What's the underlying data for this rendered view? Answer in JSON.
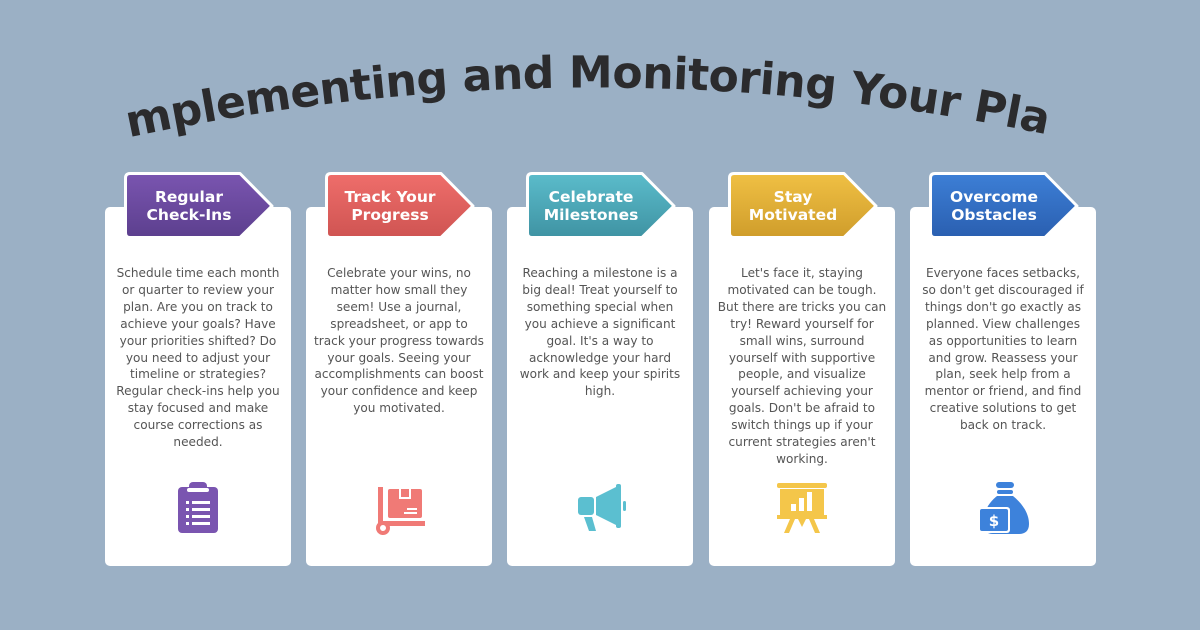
{
  "title": "Implementing and Monitoring Your Plan",
  "colors": {
    "background": "#9bb0c5",
    "title": "#2b2b2d",
    "card": "#ffffff",
    "body_text": "#555555"
  },
  "cards": [
    {
      "heading": "Regular\nCheck-Ins",
      "color_top": "#7a55b0",
      "color_bottom": "#5c3f8e",
      "icon": "clipboard-list-icon",
      "icon_color": "#7a55b0",
      "body": "Schedule time each month or quarter to review your plan. Are you on track to achieve your goals? Have your priorities shifted? Do you need to adjust your timeline or strategies? Regular check-ins help you stay focused and make course corrections as needed."
    },
    {
      "heading": "Track Your\nProgress",
      "color_top": "#ef6e6b",
      "color_bottom": "#cf5452",
      "icon": "hand-truck-box-icon",
      "icon_color": "#f07a76",
      "body": "Celebrate your wins, no matter how small they seem! Use a journal, spreadsheet, or app to track your progress towards your goals. Seeing your accomplishments can boost your confidence and keep you motivated."
    },
    {
      "heading": "Celebrate\nMilestones",
      "color_top": "#5bbccb",
      "color_bottom": "#3f93a3",
      "icon": "megaphone-icon",
      "icon_color": "#5bbfd0",
      "body": "Reaching a milestone is a big deal! Treat yourself to something special when you achieve a significant goal. It's a way to acknowledge your hard work and keep your spirits high."
    },
    {
      "heading": "Stay\nMotivated",
      "color_top": "#f0c044",
      "color_bottom": "#cf9d2b",
      "icon": "presentation-chart-icon",
      "icon_color": "#f4c64a",
      "body": "Let's face it, staying motivated can be tough. But there are tricks you can try! Reward yourself for small wins, surround yourself with supportive people, and visualize yourself achieving your goals. Don't be afraid to switch things up if your current strategies aren't working."
    },
    {
      "heading": "Overcome\nObstacles",
      "color_top": "#3d7fd6",
      "color_bottom": "#2a5fb0",
      "icon": "money-bag-icon",
      "icon_color": "#3d82db",
      "body": "Everyone faces setbacks, so don't get discouraged if things don't go exactly as planned. View challenges as opportunities to learn and grow. Reassess your plan, seek help from a mentor or friend, and find creative solutions to get back on track."
    }
  ]
}
